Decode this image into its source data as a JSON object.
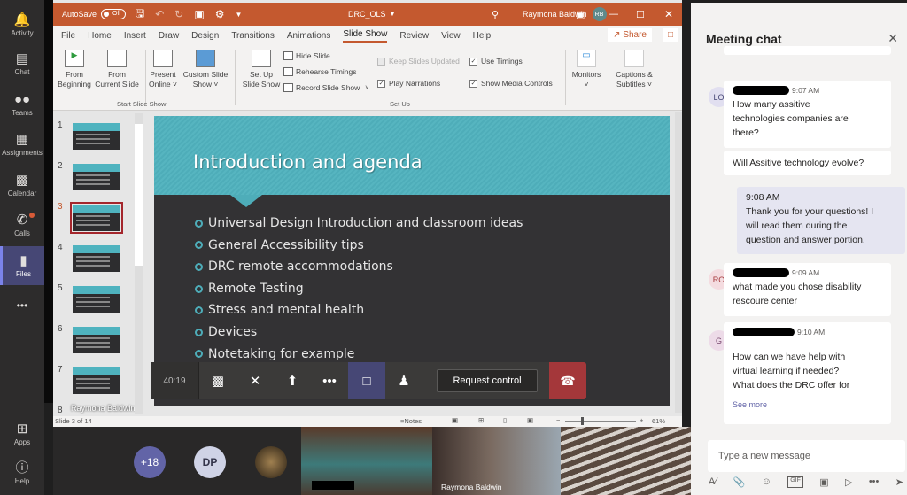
{
  "rail": {
    "items": [
      {
        "label": "Activity",
        "icon": "bell-icon"
      },
      {
        "label": "Chat",
        "icon": "chat-icon"
      },
      {
        "label": "Teams",
        "icon": "teams-icon"
      },
      {
        "label": "Assignments",
        "icon": "assignments-icon"
      },
      {
        "label": "Calendar",
        "icon": "calendar-icon"
      },
      {
        "label": "Calls",
        "icon": "phone-icon"
      },
      {
        "label": "Files",
        "icon": "file-icon"
      }
    ],
    "more": "•••",
    "apps": "Apps",
    "help": "Help",
    "active": "Files"
  },
  "ppt": {
    "autosave_label": "AutoSave",
    "autosave_state": "Off",
    "doc_title": "DRC_OLS",
    "user_name": "Raymona Baldwin",
    "user_initials": "RB",
    "menu": [
      "File",
      "Home",
      "Insert",
      "Draw",
      "Design",
      "Transitions",
      "Animations",
      "Slide Show",
      "Review",
      "View",
      "Help"
    ],
    "active_menu": "Slide Show",
    "share_label": "Share",
    "ribbon": {
      "from_beginning": [
        "From",
        "Beginning"
      ],
      "from_current": [
        "From",
        "Current Slide"
      ],
      "present_online": [
        "Present",
        "Online ˅"
      ],
      "custom_show": [
        "Custom Slide",
        "Show ˅"
      ],
      "group1": "Start Slide Show",
      "setup_show": [
        "Set Up",
        "Slide Show"
      ],
      "hide_slide": "Hide Slide",
      "rehearse": "Rehearse Timings",
      "record": "Record Slide Show",
      "keep_updated": "Keep Slides Updated",
      "use_timings": "Use Timings",
      "play_narrations": "Play Narrations",
      "show_media": "Show Media Controls",
      "group2": "Set Up",
      "monitors": [
        "Monitors",
        "˅"
      ],
      "captions": [
        "Captions &",
        "Subtitles ˅"
      ]
    },
    "slide_count_label": "Slide 3 of 14",
    "thumb_numbers": [
      "1",
      "2",
      "3",
      "4",
      "5",
      "6",
      "7",
      "8"
    ],
    "current_slide": 3,
    "presenter_overlay": "Raymona Baldwin",
    "notes_label": "Notes",
    "zoom_level": "61%",
    "slide": {
      "title": "Introduction and agenda",
      "bullets": [
        "Universal Design Introduction and classroom ideas",
        "General Accessibility tips",
        "DRC remote accommodations",
        "Remote Testing",
        "Stress and mental health",
        "Devices",
        "Notetaking for example"
      ]
    }
  },
  "call_bar": {
    "duration": "40:19",
    "request_control": "Request control"
  },
  "chat": {
    "title": "Meeting chat",
    "messages": [
      {
        "initials": "LO",
        "time": "9:07 AM",
        "text": [
          "How many assitive",
          "technologies companies are",
          "there?"
        ]
      },
      {
        "text": [
          "Will Assitive technology evolve?"
        ]
      },
      {
        "mine": true,
        "time": "9:08 AM",
        "text": [
          "Thank you for your questions!  I",
          "will read them during the",
          "question and answer portion."
        ]
      },
      {
        "initials": "RO",
        "time": "9:09 AM",
        "text": [
          "what made you chose disability",
          "rescoure center"
        ]
      },
      {
        "initials": "G",
        "time": "9:10 AM",
        "text": [
          "How can we have help with",
          "virtual learning if needed?",
          "What does the DRC offer for"
        ],
        "see_more": "See more"
      }
    ],
    "compose_placeholder": "Type a new message"
  },
  "gallery": {
    "overflow": "+18",
    "dp": "DP",
    "tile_name": "Raymona Baldwin"
  }
}
